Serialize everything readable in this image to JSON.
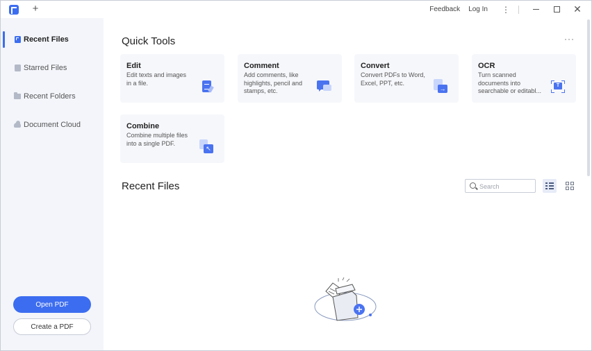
{
  "titlebar": {
    "new_tab": "+",
    "feedback": "Feedback",
    "login": "Log In",
    "more": "⋮",
    "close": "✕"
  },
  "sidebar": {
    "items": [
      {
        "label": "Recent Files",
        "icon": "recent-files-icon",
        "active": true
      },
      {
        "label": "Starred Files",
        "icon": "star-icon",
        "active": false
      },
      {
        "label": "Recent Folders",
        "icon": "folder-icon",
        "active": false
      },
      {
        "label": "Document Cloud",
        "icon": "cloud-icon",
        "active": false
      }
    ],
    "open_pdf": "Open PDF",
    "create_pdf": "Create a PDF"
  },
  "quick_tools": {
    "title": "Quick Tools",
    "more": "···",
    "tools": [
      {
        "title": "Edit",
        "desc": "Edit texts and images in a file.",
        "icon": "edit-icon"
      },
      {
        "title": "Comment",
        "desc": "Add comments, like highlights, pencil and stamps, etc.",
        "icon": "comment-icon"
      },
      {
        "title": "Convert",
        "desc": "Convert PDFs to Word, Excel, PPT, etc.",
        "icon": "convert-icon"
      },
      {
        "title": "OCR",
        "desc": "Turn scanned documents into searchable or editabl...",
        "icon": "ocr-icon"
      },
      {
        "title": "Combine",
        "desc": "Combine multiple files into a single PDF.",
        "icon": "combine-icon"
      }
    ]
  },
  "recent_files": {
    "title": "Recent Files",
    "search_placeholder": "Search"
  },
  "colors": {
    "accent": "#3c6df0",
    "sidebar_bg": "#f3f5fa",
    "card_bg": "#f6f7fb"
  }
}
